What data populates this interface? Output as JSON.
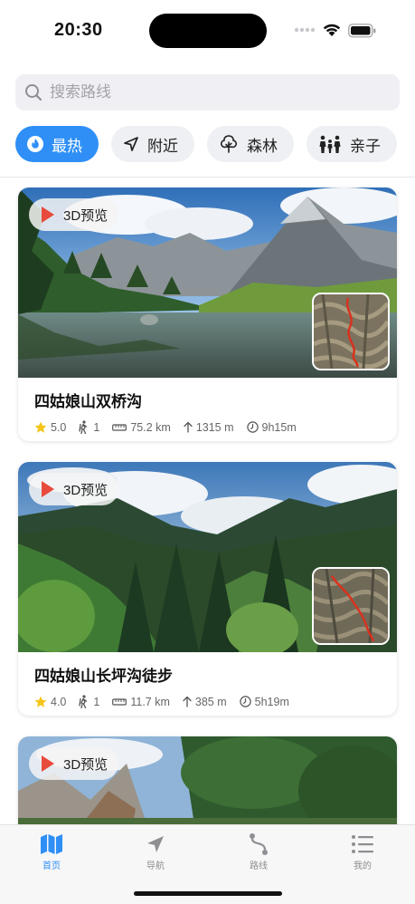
{
  "status_bar": {
    "time": "20:30"
  },
  "search": {
    "placeholder": "搜索路线"
  },
  "chips": [
    {
      "label": "最热",
      "icon": "flame-icon",
      "active": true
    },
    {
      "label": "附近",
      "icon": "location-arrow-icon",
      "active": false
    },
    {
      "label": "森林",
      "icon": "tree-icon",
      "active": false
    },
    {
      "label": "亲子",
      "icon": "family-icon",
      "active": false
    }
  ],
  "cards": [
    {
      "preview_label": "3D预览",
      "title": "四姑娘山双桥沟",
      "rating": "5.0",
      "difficulty": "1",
      "distance": "75.2 km",
      "elevation": "1315 m",
      "duration": "9h15m"
    },
    {
      "preview_label": "3D预览",
      "title": "四姑娘山长坪沟徒步",
      "rating": "4.0",
      "difficulty": "1",
      "distance": "11.7 km",
      "elevation": "385 m",
      "duration": "5h19m"
    },
    {
      "preview_label": "3D预览"
    }
  ],
  "tabbar": [
    {
      "label": "首页",
      "icon": "map-icon",
      "active": true
    },
    {
      "label": "导航",
      "icon": "navigation-icon",
      "active": false
    },
    {
      "label": "路线",
      "icon": "route-icon",
      "active": false
    },
    {
      "label": "我的",
      "icon": "list-icon",
      "active": false
    }
  ],
  "colors": {
    "accent": "#2f8ff6",
    "play": "#e84a3b",
    "star": "#f5c518"
  }
}
